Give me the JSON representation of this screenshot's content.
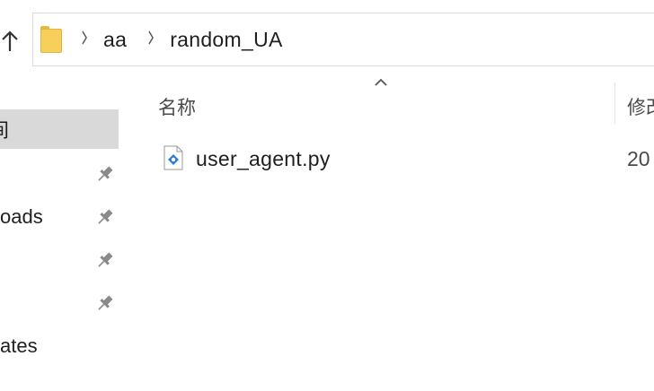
{
  "address_bar": {
    "breadcrumbs": [
      "aa",
      "random_UA"
    ],
    "separator_icon": "chevron-right-icon",
    "folder_icon": "folder-icon",
    "folder_color": "#f7cf5b"
  },
  "nav": {
    "up_icon": "up-arrow-icon",
    "items": [
      {
        "label": "",
        "selected": true,
        "pinned": false
      },
      {
        "label": "",
        "selected": false,
        "pinned": true
      },
      {
        "label": "oads",
        "selected": false,
        "pinned": true
      },
      {
        "label": "",
        "selected": false,
        "pinned": true
      },
      {
        "label": "",
        "selected": false,
        "pinned": true
      },
      {
        "label": "ates",
        "selected": false,
        "pinned": false
      }
    ],
    "selected_glyph": "间",
    "selected_bg": "#d9d9d9",
    "pin_icon": "pin-icon"
  },
  "columns": {
    "name_header": "名称",
    "date_header": "修改",
    "sort_icon": "sort-ascending-icon"
  },
  "files": [
    {
      "name": "user_agent.py",
      "date": "20",
      "icon": "python-file-icon"
    }
  ]
}
